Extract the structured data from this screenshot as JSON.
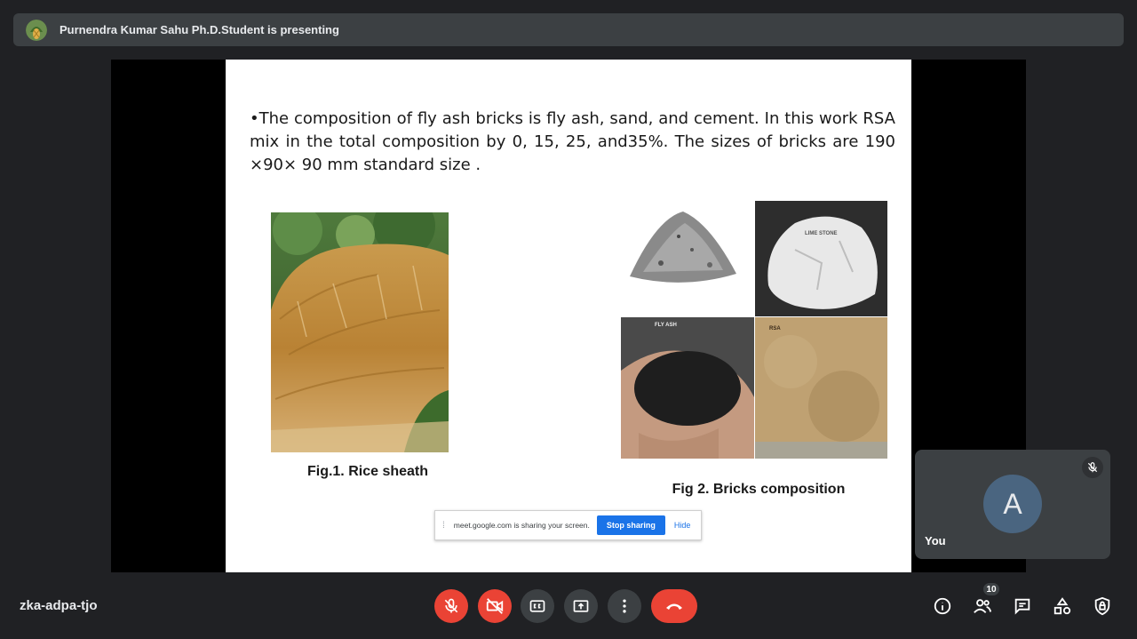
{
  "presenter": {
    "text": "Purnendra Kumar Sahu Ph.D.Student is presenting"
  },
  "slide": {
    "body": "•The composition of fly ash bricks is fly ash, sand, and cement. In this work RSA mix in the total composition by 0, 15, 25, and35%. The sizes of bricks are 190 ×90× 90 mm standard size .",
    "fig1_caption": "Fig.1. Rice sheath",
    "fig2_caption": "Fig 2. Bricks composition",
    "fig2_labels": {
      "limestone": "LIME STONE",
      "flyash": "FLY ASH",
      "rsa": "RSA"
    }
  },
  "share_bar": {
    "message": "meet.google.com is sharing your screen.",
    "stop_label": "Stop sharing",
    "hide_label": "Hide"
  },
  "self_tile": {
    "initial": "A",
    "label": "You"
  },
  "meeting": {
    "code": "zka-adpa-tjo"
  },
  "people": {
    "count": "10"
  },
  "colors": {
    "danger": "#ea4335",
    "surface": "#3c4043",
    "background": "#202124",
    "accent": "#1a73e8"
  }
}
